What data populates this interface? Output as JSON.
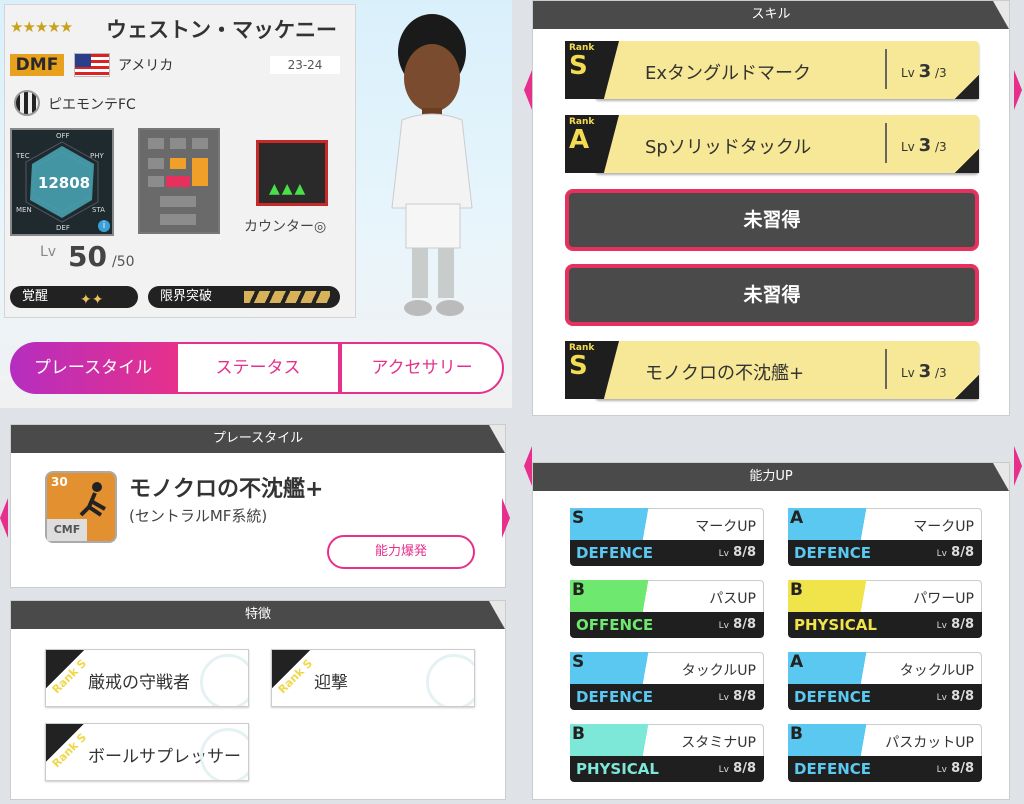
{
  "player": {
    "stars": "★★★★★",
    "name": "ウェストン・マッケニー",
    "position": "DMF",
    "country": "アメリカ",
    "season": "23-24",
    "club": "ピエモンテFC",
    "radar_total": "12808",
    "radar_labels": [
      "OFF",
      "PHY",
      "STA",
      "DEF",
      "MEN",
      "TEC"
    ],
    "counter": "カウンター◎",
    "lv_label": "Lv",
    "lv": "50",
    "lv_max": "/50",
    "awakening_label": "覚醒",
    "awakening_diamonds": "✦✦",
    "limit_label": "限界突破"
  },
  "tabs": [
    "プレースタイル",
    "ステータス",
    "アクセサリー"
  ],
  "playstyle": {
    "header": "プレースタイル",
    "level": "30",
    "pos": "CMF",
    "name": "モノクロの不沈艦+",
    "sub": "(セントラルMF系統)",
    "button": "能力爆発"
  },
  "traits": {
    "header": "特徴",
    "items": [
      {
        "rank": "Rank S",
        "label": "厳戒の守戦者"
      },
      {
        "rank": "Rank S",
        "label": "迎撃"
      },
      {
        "rank": "Rank S",
        "label": "ボールサプレッサー"
      }
    ]
  },
  "skills": {
    "header": "スキル",
    "items": [
      {
        "rank_label": "Rank",
        "rank": "S",
        "name": "Exタングルドマーク",
        "lv_label": "Lv",
        "lv": "3",
        "lv_max": "/3"
      },
      {
        "rank_label": "Rank",
        "rank": "A",
        "name": "Spソリッドタックル",
        "lv_label": "Lv",
        "lv": "3",
        "lv_max": "/3"
      },
      {
        "empty": "未習得"
      },
      {
        "empty": "未習得"
      },
      {
        "rank_label": "Rank",
        "rank": "S",
        "name": "モノクロの不沈艦+",
        "lv_label": "Lv",
        "lv": "3",
        "lv_max": "/3"
      }
    ]
  },
  "abilities": {
    "header": "能力UP",
    "items": [
      {
        "rank": "S",
        "label": "マークUP",
        "category": "DEFENCE",
        "lv": "8",
        "lv_max": "/8",
        "color": "#5ac8f0"
      },
      {
        "rank": "A",
        "label": "マークUP",
        "category": "DEFENCE",
        "lv": "8",
        "lv_max": "/8",
        "color": "#5ac8f0"
      },
      {
        "rank": "B",
        "label": "パスUP",
        "category": "OFFENCE",
        "lv": "8",
        "lv_max": "/8",
        "color": "#6ee86e"
      },
      {
        "rank": "B",
        "label": "パワーUP",
        "category": "PHYSICAL",
        "lv": "8",
        "lv_max": "/8",
        "color": "#f0e44a"
      },
      {
        "rank": "S",
        "label": "タックルUP",
        "category": "DEFENCE",
        "lv": "8",
        "lv_max": "/8",
        "color": "#5ac8f0"
      },
      {
        "rank": "A",
        "label": "タックルUP",
        "category": "DEFENCE",
        "lv": "8",
        "lv_max": "/8",
        "color": "#5ac8f0"
      },
      {
        "rank": "B",
        "label": "スタミナUP",
        "category": "PHYSICAL",
        "lv": "8",
        "lv_max": "/8",
        "color": "#7de8d8"
      },
      {
        "rank": "B",
        "label": "パスカットUP",
        "category": "DEFENCE",
        "lv": "8",
        "lv_max": "/8",
        "color": "#5ac8f0"
      }
    ],
    "lv_label": "Lv"
  },
  "colors": {
    "accent": "#e6308c",
    "skill_yellow": "#f6e896",
    "rank_gold": "#f3dc52"
  }
}
